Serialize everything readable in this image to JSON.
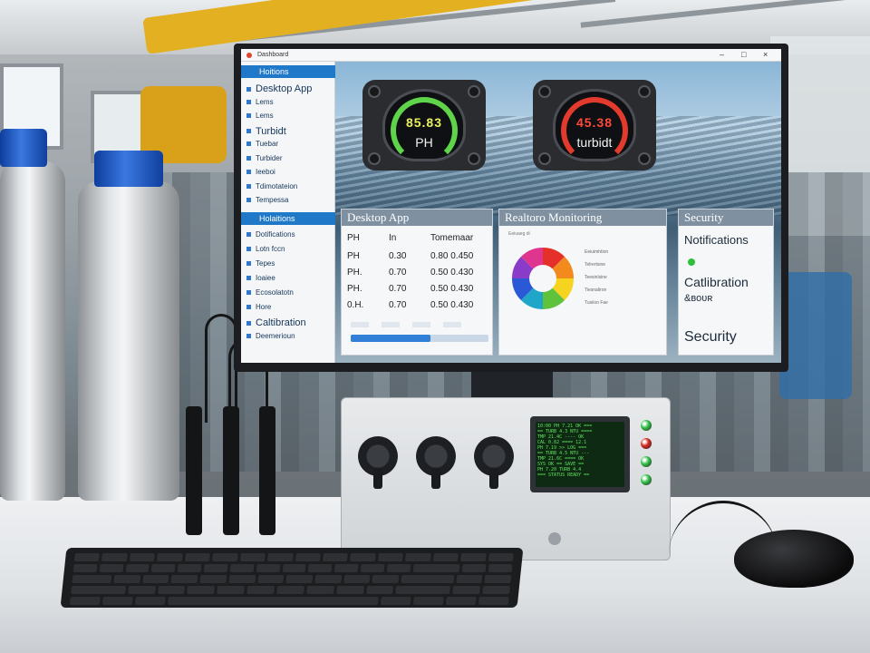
{
  "window": {
    "title": "Dashboard",
    "controls": [
      "–",
      "□",
      "×"
    ]
  },
  "sidebar": {
    "section1_header": "Hoitions",
    "items1": [
      {
        "label": "Desktop App",
        "big": true
      },
      {
        "label": "Lems"
      },
      {
        "label": "Lems"
      },
      {
        "label": "Turbidt",
        "big": true
      },
      {
        "label": "Tuebar"
      },
      {
        "label": "Turbider"
      },
      {
        "label": "Ieeboi"
      },
      {
        "label": "Tdimotateion"
      },
      {
        "label": "Tempessa"
      }
    ],
    "section2_header": "Holaitions",
    "items2": [
      {
        "label": "Dotifications"
      },
      {
        "label": "Lotn fccn"
      },
      {
        "label": "Tepes"
      },
      {
        "label": "Ioaiee"
      },
      {
        "label": "Ecosolatotn"
      },
      {
        "label": "Hore"
      },
      {
        "label": "Caltibration",
        "big": true
      },
      {
        "label": "Deemerioun"
      }
    ]
  },
  "gauges": [
    {
      "value": "85.83",
      "label": "PH",
      "value_color": "#e8f05a",
      "arc_color": "#5fd34a"
    },
    {
      "value": "45.38",
      "label": "turbidt",
      "value_color": "#ff4a3a",
      "arc_color": "#e23a2c"
    }
  ],
  "panels": {
    "desktop_app": {
      "title": "Desktop App",
      "headers": [
        "PH",
        "In",
        "Tomemaar"
      ],
      "rows": [
        [
          "PH",
          "0.30",
          "0.80 0.450"
        ],
        [
          "PH.",
          "0.70",
          "0.50 0.430"
        ],
        [
          "PH.",
          "0.70",
          "0.50 0.430"
        ],
        [
          "0.H.",
          "0.70",
          "0.50 0.430"
        ]
      ],
      "progress": 0.58
    },
    "monitoring": {
      "title": "Realtoro Monitoring",
      "subtitle": "Eeiuaeg di",
      "legend": [
        "Eeiuimhtion",
        "Telrertsine",
        "Teesinlsine",
        "Tiesnaliron",
        "Tusiioo Fae"
      ]
    },
    "security": {
      "title": "Security",
      "items": [
        "Notifications",
        "Catlibration",
        "&ʙᴏᴜʀ",
        "Security"
      ]
    }
  },
  "device": {
    "lcd_lines": [
      "10:00 PH 7.21 OK ===",
      "== TURB 4.3 NTU ====",
      "TMP 21.4C  ---- OK",
      "CAL 0.82 ==== 12.1",
      "PH 7.19 >> LOG ===",
      "== TURB 4.5 NTU ---",
      "TMP 21.6C ==== OK",
      "SYS OK  == SAVE ==",
      "PH 7.20  TURB 4.4",
      "=== STATUS READY =="
    ],
    "leds": [
      "#35c24a",
      "#d52a22",
      "#35c24a",
      "#35c24a"
    ]
  }
}
